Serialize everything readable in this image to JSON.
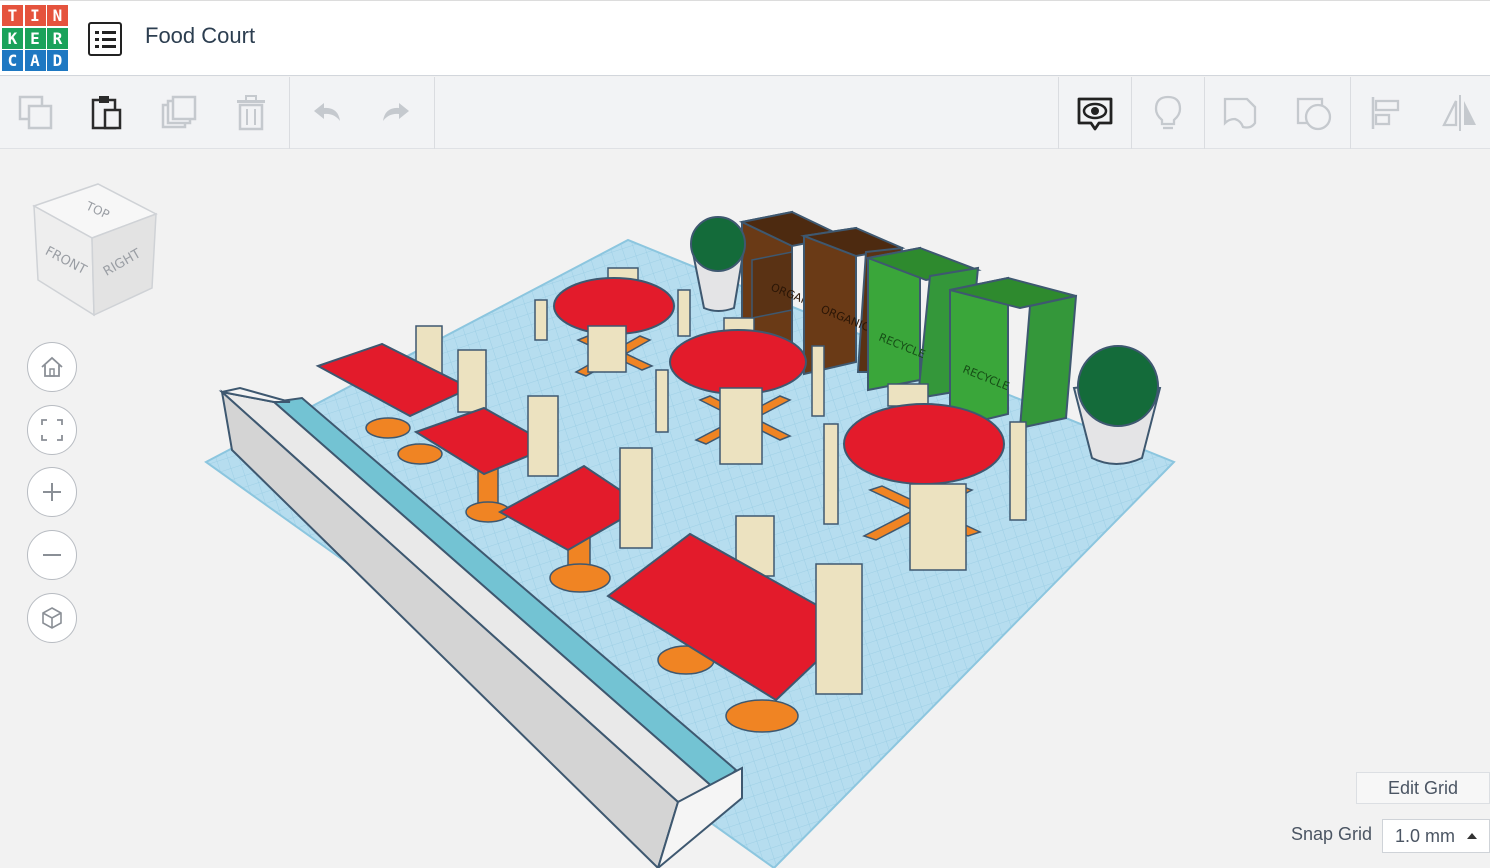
{
  "app": {
    "logo_letters": [
      "T",
      "I",
      "N",
      "K",
      "E",
      "R",
      "C",
      "A",
      "D"
    ],
    "title": "Food Court"
  },
  "toolbar": {
    "left_tools": [
      "copy-icon",
      "paste-icon",
      "duplicate-icon",
      "delete-icon",
      "undo-icon",
      "redo-icon"
    ],
    "right_tools": [
      "show-all-icon",
      "light-bulb-icon",
      "notes-icon",
      "group-icon",
      "align-icon",
      "mirror-icon"
    ]
  },
  "viewcube": {
    "top": "TOP",
    "front": "FRONT",
    "right": "RIGHT"
  },
  "nav": [
    "home-icon",
    "fit-view-icon",
    "zoom-in-icon",
    "zoom-out-icon",
    "perspective-icon"
  ],
  "scene": {
    "bin_labels": [
      "ORGANIC",
      "ORGANIC",
      "RECYCLE",
      "RECYCLE"
    ],
    "colors": {
      "grid": "#a9d7ec",
      "table": "#e31b2b",
      "leg": "#f08423",
      "chair": "#ece2c0",
      "bin_brown": "#6a3a16",
      "bin_green": "#3aa63a",
      "plant": "#146b3a"
    }
  },
  "bottom": {
    "edit_grid": "Edit Grid",
    "snap_label": "Snap Grid",
    "snap_value": "1.0 mm"
  }
}
